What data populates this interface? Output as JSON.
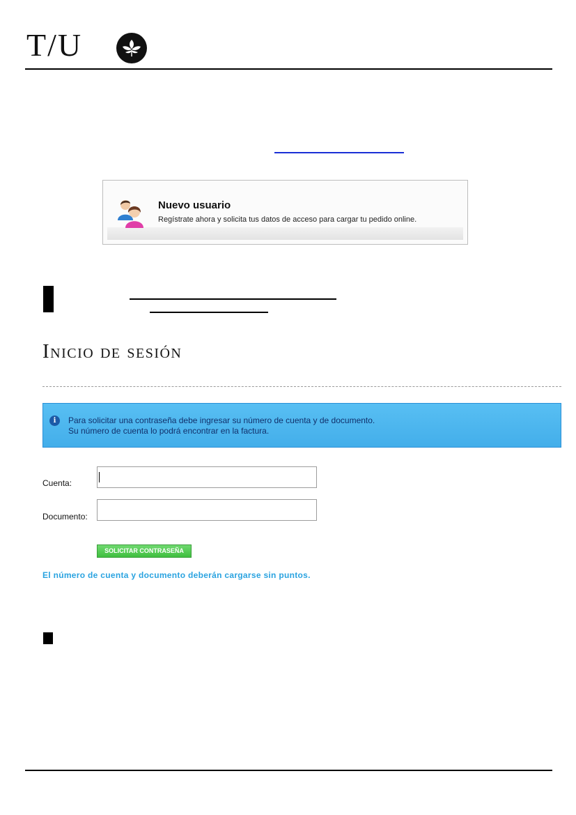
{
  "header": {
    "logo_text": "T/U",
    "logo_mark_icon": "flower-emblem-icon"
  },
  "nuevo_usuario": {
    "icon": "users-icon",
    "title": "Nuevo usuario",
    "subtitle": "Regístrate ahora y solicita tus datos de acceso para cargar tu pedido online."
  },
  "login": {
    "title": "Inicio de sesión",
    "alert": {
      "icon": "info-icon",
      "line1": "Para solicitar una contraseña debe ingresar su número de cuenta y de documento.",
      "line2": "Su número de cuenta lo podrá encontrar en la factura."
    },
    "cuenta": {
      "label": "Cuenta:",
      "value": ""
    },
    "documento": {
      "label": "Documento:",
      "value": ""
    },
    "submit_label": "SOLICITAR CONTRASEÑA",
    "hint": "El número de cuenta y documento deberán cargarse sin puntos."
  },
  "colors": {
    "link": "#1a2fd6",
    "alert_bg": "#4db6ee",
    "button": "#4cc74c",
    "hint": "#2aa3e0"
  }
}
